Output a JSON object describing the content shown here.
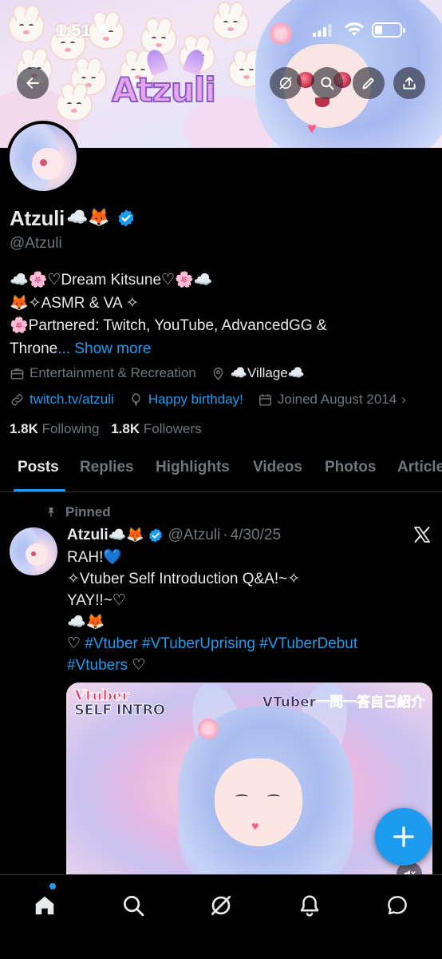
{
  "status_bar": {
    "time": "1:51"
  },
  "banner": {
    "logo_text": "Atzuli"
  },
  "profile": {
    "display_name": "Atzuli",
    "name_emoji": "☁️🦊",
    "handle": "@Atzuli",
    "bio_lines": [
      "☁️🌸♡Dream Kitsune♡🌸☁️",
      "🦊✧ASMR & VA ✧",
      "🌸Partnered: Twitch, YouTube, AdvancedGG &"
    ],
    "bio_last": "Throne",
    "bio_ellipsis": "...",
    "show_more": "Show more",
    "category": "Entertainment & Recreation",
    "location": "☁️Village☁️",
    "website": "twitch.tv/atzuli",
    "birthday": "Happy birthday!",
    "joined": "Joined August 2014",
    "following_count": "1.8K",
    "following_label": "Following",
    "followers_count": "1.8K",
    "followers_label": "Followers"
  },
  "tabs": [
    "Posts",
    "Replies",
    "Highlights",
    "Videos",
    "Photos",
    "Articles"
  ],
  "active_tab": "Posts",
  "pinned_post": {
    "pinned_label": "Pinned",
    "author_name": "Atzuli",
    "author_emoji": "☁️🦊",
    "author_handle": "@Atzuli",
    "separator": "·",
    "date": "4/30/25",
    "lines": {
      "l1": "RAH!💙",
      "l2": "✧Vtuber Self Introduction Q&A!~✧",
      "l3": "YAY!!~♡",
      "l4": "☁️🦊",
      "l5_prefix": "♡ ",
      "l5_tags": "#Vtuber #VTuberUprising #VTuberDebut",
      "l6_tag": "#Vtubers",
      "l6_suffix": " ♡"
    },
    "media": {
      "title_top": "Vtuber",
      "title_bottom": "SELF INTRO",
      "jp_title": "VTuber一問一答自己紹介"
    }
  },
  "icons": {
    "back": "back-arrow-icon",
    "grok": "grok-icon",
    "search": "search-icon",
    "edit": "pencil-icon",
    "share": "share-icon",
    "verified": "verified-badge-icon",
    "x": "x-logo-icon",
    "compose": "plus-icon",
    "nav": [
      "home-icon",
      "search-icon",
      "grok-icon",
      "bell-icon",
      "chat-icon"
    ]
  },
  "colors": {
    "accent": "#1d9bf0",
    "background": "#000000",
    "muted": "#71767b",
    "text": "#e7e9ea"
  }
}
